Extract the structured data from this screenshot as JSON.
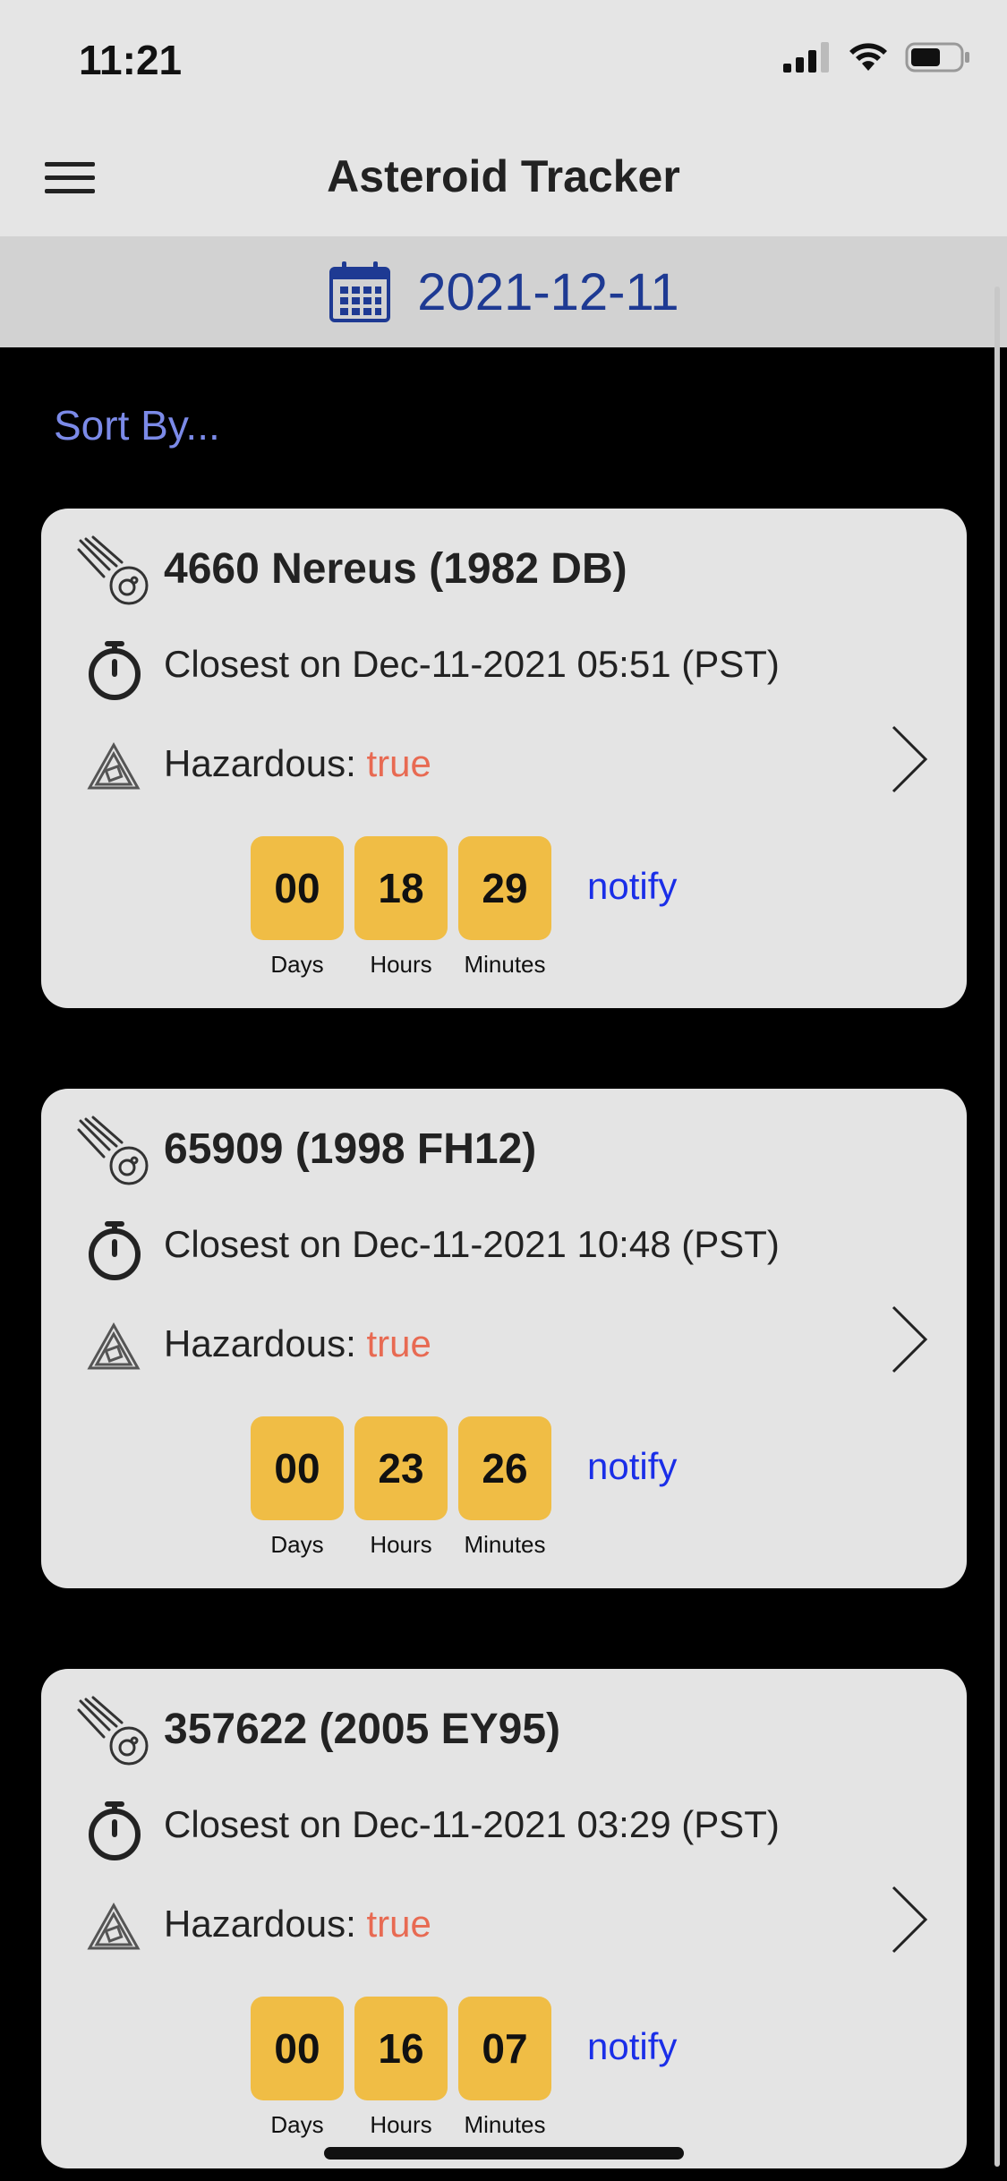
{
  "status_bar": {
    "time": "11:21"
  },
  "header": {
    "title": "Asteroid Tracker"
  },
  "date_selector": {
    "date": "2021-12-11"
  },
  "sort": {
    "label": "Sort By..."
  },
  "asteroids": [
    {
      "name": "4660 Nereus (1982 DB)",
      "closest": "Closest on Dec-11-2021 05:51 (PST)",
      "hazardous_label": "Hazardous: ",
      "hazardous_value": "true",
      "countdown": {
        "days": "00",
        "hours": "18",
        "minutes": "29"
      },
      "notify_label": "notify"
    },
    {
      "name": "65909 (1998 FH12)",
      "closest": "Closest on Dec-11-2021 10:48 (PST)",
      "hazardous_label": "Hazardous: ",
      "hazardous_value": "true",
      "countdown": {
        "days": "00",
        "hours": "23",
        "minutes": "26"
      },
      "notify_label": "notify"
    },
    {
      "name": "357622 (2005 EY95)",
      "closest": "Closest on Dec-11-2021 03:29 (PST)",
      "hazardous_label": "Hazardous: ",
      "hazardous_value": "true",
      "countdown": {
        "days": "00",
        "hours": "16",
        "minutes": "07"
      },
      "notify_label": "notify"
    }
  ],
  "countdown_labels": {
    "days": "Days",
    "hours": "Hours",
    "minutes": "Minutes"
  },
  "colors": {
    "accent_link": "#1a2ee8",
    "sort_link": "#7b8ae8",
    "hazard_true": "#e86a52",
    "countdown_box": "#f0bd45",
    "date_text": "#1e3a93"
  },
  "icons": {
    "menu": "hamburger-menu-icon",
    "calendar": "calendar-icon",
    "asteroid": "comet-icon",
    "closest": "stopwatch-icon",
    "hazard": "warning-triangle-icon",
    "open": "chevron-right-icon"
  }
}
